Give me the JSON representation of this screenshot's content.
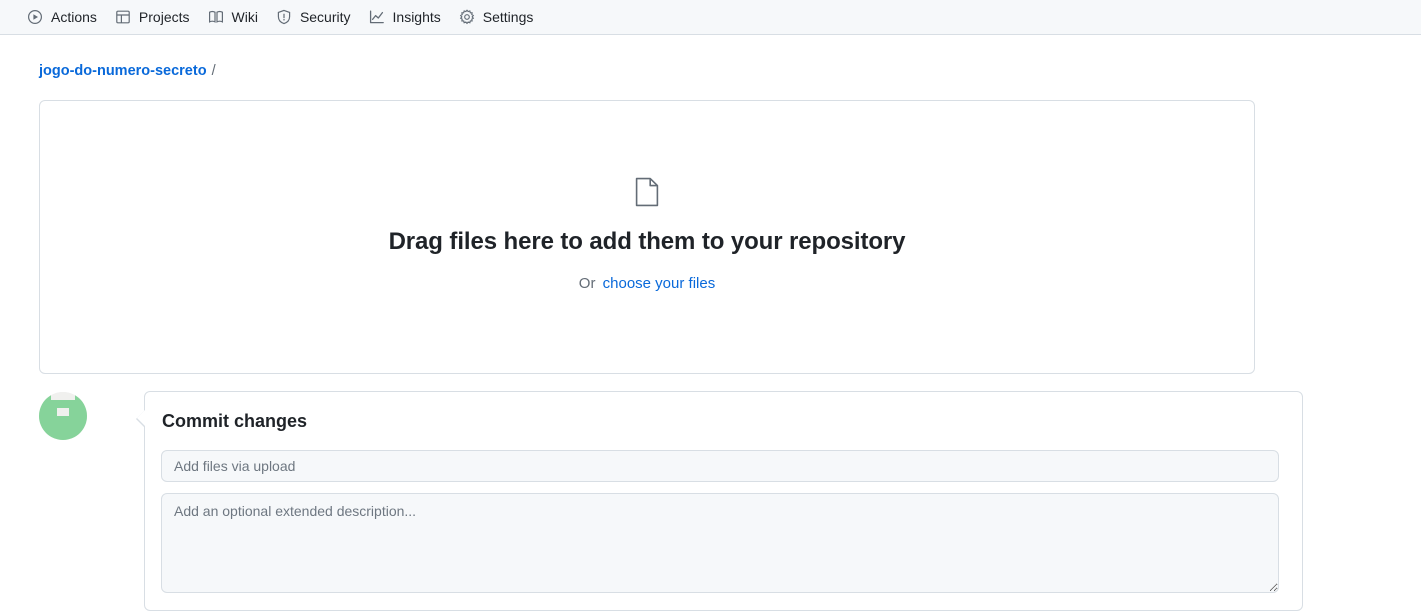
{
  "nav": {
    "items": [
      {
        "label": "Actions",
        "icon": "play-circle-icon"
      },
      {
        "label": "Projects",
        "icon": "table-icon"
      },
      {
        "label": "Wiki",
        "icon": "book-icon"
      },
      {
        "label": "Security",
        "icon": "shield-icon"
      },
      {
        "label": "Insights",
        "icon": "graph-icon"
      },
      {
        "label": "Settings",
        "icon": "gear-icon"
      }
    ]
  },
  "breadcrumb": {
    "repo": "jogo-do-numero-secreto",
    "separator": "/"
  },
  "dropzone": {
    "icon": "file-icon",
    "title": "Drag files here to add them to your repository",
    "or_text": "Or",
    "choose_link": "choose your files"
  },
  "commit": {
    "avatar": "identicon-avatar",
    "heading": "Commit changes",
    "message_value": "",
    "message_placeholder": "Add files via upload",
    "description_value": "",
    "description_placeholder": "Add an optional extended description..."
  },
  "colors": {
    "link": "#0969da",
    "header_bg": "#f6f8fa",
    "border": "#d8dee4",
    "muted_text": "#636c76",
    "text": "#1f2328",
    "avatar_green": "#86d39a"
  }
}
